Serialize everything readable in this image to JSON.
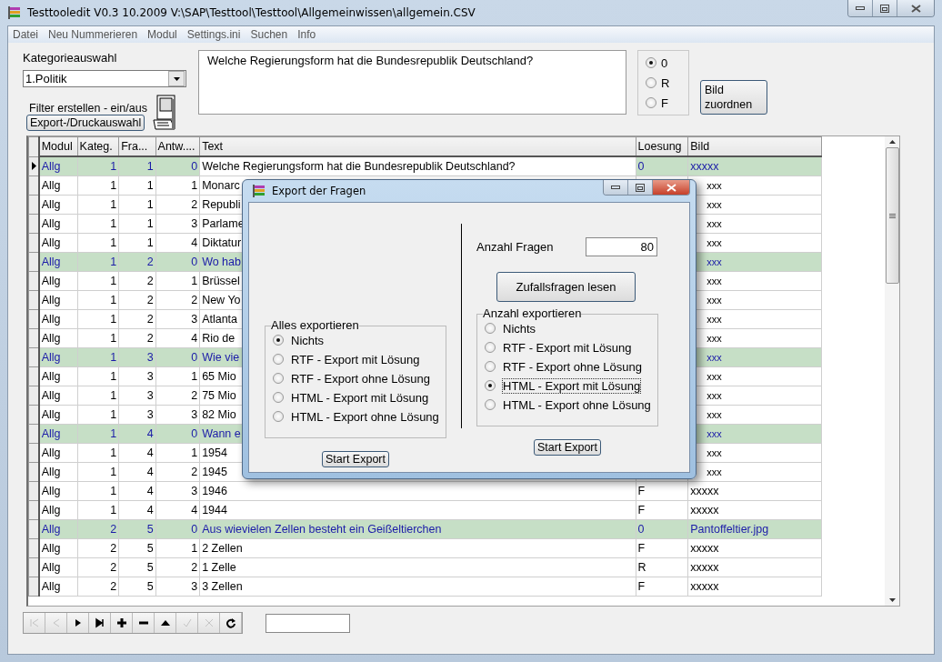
{
  "window": {
    "title": "Testtooledit V0.3 10.2009 V:\\SAP\\Testtool\\Testtool\\Allgemeinwissen\\allgemein.CSV"
  },
  "menu": [
    "Datei",
    "Neu Nummerieren",
    "Modul",
    "Settings.ini",
    "Suchen",
    "Info"
  ],
  "category": {
    "label": "Kategorieauswahl",
    "value": "1.Politik"
  },
  "filter": {
    "label": "Filter erstellen - ein/aus",
    "button": "Export-/Druckauswahl"
  },
  "question": {
    "value": "Welche Regierungsform hat die Bundesrepublik Deutschland?"
  },
  "solution_options": [
    {
      "label": "0",
      "selected": true
    },
    {
      "label": "R",
      "selected": false
    },
    {
      "label": "F",
      "selected": false
    }
  ],
  "image_button": "Bild zuordnen",
  "table": {
    "columns": [
      "Modul",
      "Kateg.",
      "Fra...",
      "Antw....",
      "Text",
      "Loesung",
      "Bild"
    ],
    "rows": [
      {
        "kind": "question",
        "selected": true,
        "cells": [
          "Allg",
          "1",
          "1",
          "0",
          "Welche Regierungsform hat die Bundesrepublik Deutschland?",
          "0",
          "xxxxx"
        ]
      },
      {
        "kind": "answer",
        "selected": false,
        "cells": [
          "Allg",
          "1",
          "1",
          "1",
          "Monarc",
          null,
          "xxx"
        ]
      },
      {
        "kind": "answer",
        "selected": false,
        "cells": [
          "Allg",
          "1",
          "1",
          "2",
          "Republi",
          null,
          "xxx"
        ]
      },
      {
        "kind": "answer",
        "selected": false,
        "cells": [
          "Allg",
          "1",
          "1",
          "3",
          "Parlame",
          null,
          "xxx"
        ]
      },
      {
        "kind": "answer",
        "selected": false,
        "cells": [
          "Allg",
          "1",
          "1",
          "4",
          "Diktatur",
          null,
          "xxx"
        ]
      },
      {
        "kind": "question",
        "selected": false,
        "cells": [
          "Allg",
          "1",
          "2",
          "0",
          "Wo hab",
          null,
          "xxx"
        ]
      },
      {
        "kind": "answer",
        "selected": false,
        "cells": [
          "Allg",
          "1",
          "2",
          "1",
          "Brüssel",
          null,
          "xxx"
        ]
      },
      {
        "kind": "answer",
        "selected": false,
        "cells": [
          "Allg",
          "1",
          "2",
          "2",
          "New Yo",
          null,
          "xxx"
        ]
      },
      {
        "kind": "answer",
        "selected": false,
        "cells": [
          "Allg",
          "1",
          "2",
          "3",
          "Atlanta",
          null,
          "xxx"
        ]
      },
      {
        "kind": "answer",
        "selected": false,
        "cells": [
          "Allg",
          "1",
          "2",
          "4",
          "Rio de",
          null,
          "xxx"
        ]
      },
      {
        "kind": "question",
        "selected": false,
        "cells": [
          "Allg",
          "1",
          "3",
          "0",
          "Wie vie",
          null,
          "xxx"
        ]
      },
      {
        "kind": "answer",
        "selected": false,
        "cells": [
          "Allg",
          "1",
          "3",
          "1",
          "65 Mio",
          null,
          "xxx"
        ]
      },
      {
        "kind": "answer",
        "selected": false,
        "cells": [
          "Allg",
          "1",
          "3",
          "2",
          "75 Mio",
          null,
          "xxx"
        ]
      },
      {
        "kind": "answer",
        "selected": false,
        "cells": [
          "Allg",
          "1",
          "3",
          "3",
          "82 Mio",
          null,
          "xxx"
        ]
      },
      {
        "kind": "question",
        "selected": false,
        "cells": [
          "Allg",
          "1",
          "4",
          "0",
          "Wann e",
          null,
          "xxx"
        ]
      },
      {
        "kind": "answer",
        "selected": false,
        "cells": [
          "Allg",
          "1",
          "4",
          "1",
          "1954",
          null,
          "xxx"
        ]
      },
      {
        "kind": "answer",
        "selected": false,
        "cells": [
          "Allg",
          "1",
          "4",
          "2",
          "1945",
          null,
          "xxx"
        ]
      },
      {
        "kind": "answer",
        "selected": false,
        "cells": [
          "Allg",
          "1",
          "4",
          "3",
          "1946",
          "F",
          "xxxxx"
        ]
      },
      {
        "kind": "answer",
        "selected": false,
        "cells": [
          "Allg",
          "1",
          "4",
          "4",
          "1944",
          "F",
          "xxxxx"
        ]
      },
      {
        "kind": "question",
        "selected": false,
        "cells": [
          "Allg",
          "2",
          "5",
          "0",
          "Aus wievielen Zellen besteht ein Geißeltierchen",
          "0",
          "Pantoffeltier.jpg"
        ]
      },
      {
        "kind": "answer",
        "selected": false,
        "cells": [
          "Allg",
          "2",
          "5",
          "1",
          "2 Zellen",
          "F",
          "xxxxx"
        ]
      },
      {
        "kind": "answer",
        "selected": false,
        "cells": [
          "Allg",
          "2",
          "5",
          "2",
          "1 Zelle",
          "R",
          "xxxxx"
        ]
      },
      {
        "kind": "answer",
        "selected": false,
        "cells": [
          "Allg",
          "2",
          "5",
          "3",
          "3 Zellen",
          "F",
          "xxxxx"
        ]
      }
    ]
  },
  "navigator": [
    {
      "kind": "first",
      "disabled": true
    },
    {
      "kind": "prior",
      "disabled": true
    },
    {
      "kind": "next",
      "disabled": false
    },
    {
      "kind": "last",
      "disabled": false
    },
    {
      "kind": "insert",
      "disabled": false
    },
    {
      "kind": "delete",
      "disabled": false
    },
    {
      "kind": "edit",
      "disabled": false
    },
    {
      "kind": "post",
      "disabled": true
    },
    {
      "kind": "cancel",
      "disabled": true
    },
    {
      "kind": "refresh",
      "disabled": false
    }
  ],
  "dialog": {
    "title": "Export der Fragen",
    "count_label": "Anzahl Fragen",
    "count_value": "80",
    "random_button": "Zufallsfragen lesen",
    "groups": [
      {
        "title": "Alles exportieren",
        "button": "Start Export",
        "options": [
          {
            "label": "Nichts",
            "selected": true
          },
          {
            "label": "RTF - Export mit Lösung",
            "selected": false
          },
          {
            "label": "RTF - Export ohne Lösung",
            "selected": false
          },
          {
            "label": "HTML - Export mit Lösung",
            "selected": false
          },
          {
            "label": "HTML - Export ohne Lösung",
            "selected": false
          }
        ]
      },
      {
        "title": "Anzahl exportieren",
        "button": "Start Export",
        "options": [
          {
            "label": "Nichts",
            "selected": false
          },
          {
            "label": "RTF - Export mit Lösung",
            "selected": false
          },
          {
            "label": "RTF - Export ohne Lösung",
            "selected": false
          },
          {
            "label": "HTML - Export mit Lösung",
            "selected": true
          },
          {
            "label": "HTML - Export ohne Lösung",
            "selected": false
          }
        ]
      }
    ]
  }
}
